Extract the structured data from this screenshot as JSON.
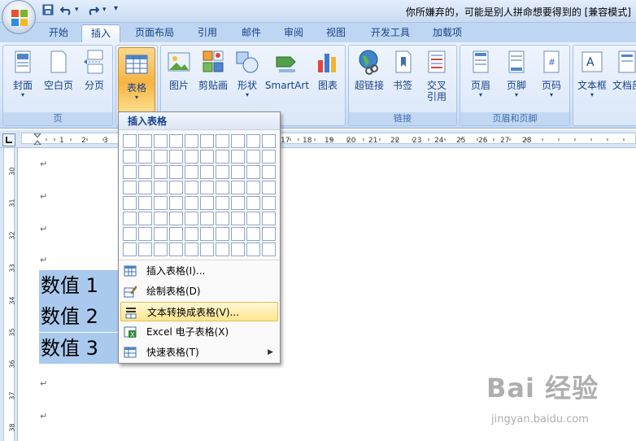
{
  "titlebar": {
    "title": "你所嫌弃的，可能是别人拼命想要得到的 [兼容模式]",
    "qat_save": "save",
    "qat_undo": "undo",
    "qat_redo": "redo",
    "qat_customize": "▾"
  },
  "tabs": [
    "开始",
    "插入",
    "页面布局",
    "引用",
    "邮件",
    "审阅",
    "视图",
    "开发工具",
    "加载项"
  ],
  "active_tab": "插入",
  "ribbon": {
    "pages_group": {
      "label": "页",
      "cover": "封面",
      "blank": "空白页",
      "break": "分页"
    },
    "table_group": {
      "label": "",
      "table": "表格"
    },
    "illustrations_group": {
      "picture": "图片",
      "clipart": "剪贴画",
      "shapes": "形状",
      "smartart": "SmartArt",
      "chart": "图表"
    },
    "links_group": {
      "label": "链接",
      "hyperlink": "超链接",
      "bookmark": "书签",
      "crossref_line1": "交叉",
      "crossref_line2": "引用"
    },
    "headerfooter_group": {
      "label": "页眉和页脚",
      "header": "页眉",
      "footer": "页脚",
      "pagenum": "页码"
    },
    "text_group": {
      "textbox": "文本框",
      "docparts": "文档部"
    }
  },
  "ruler": {
    "top_numbers": [
      "1",
      "2",
      "3",
      "17",
      "18",
      "19",
      "20",
      "21",
      "22",
      "23",
      "24",
      "25",
      "26",
      "27",
      "28"
    ],
    "left_numbers": [
      "30",
      "31",
      "32",
      "33",
      "34",
      "35",
      "36",
      "37",
      "38"
    ]
  },
  "document": {
    "para_mark": "↵",
    "lines": [
      "数值 1",
      "数值 2",
      "数值 3"
    ]
  },
  "menu": {
    "header": "插入表格",
    "items": [
      {
        "label": "插入表格(I)...",
        "icon": "insert-table-icon"
      },
      {
        "label": "绘制表格(D)",
        "icon": "draw-table-icon"
      },
      {
        "label": "文本转换成表格(V)...",
        "icon": "convert-text-to-table-icon"
      },
      {
        "label": "Excel 电子表格(X)",
        "icon": "excel-spreadsheet-icon"
      },
      {
        "label": "快速表格(T)",
        "icon": "quick-tables-icon"
      }
    ]
  },
  "watermark": {
    "logo": "Bai 经验",
    "url": "jingyan.baidu.com"
  },
  "colors": {
    "ribbon_bg": "#dce8f8",
    "tab_text": "#15428b",
    "selection": "#a9c9ee",
    "hover_item": "#ffe58c",
    "pressed_button": "#f6b443"
  }
}
